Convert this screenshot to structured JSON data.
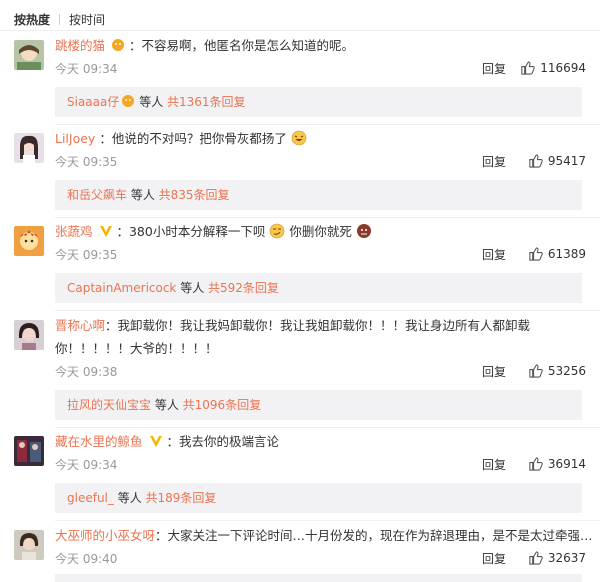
{
  "sort": {
    "hot": "按热度",
    "time": "按时间"
  },
  "labels": {
    "reply": "回复",
    "etc": " 等人 "
  },
  "comments": [
    {
      "user": "跳楼的猫",
      "text": "：不容易啊，他匿名你是怎么知道的呢。",
      "time": "今天 09:34",
      "likes": "116694",
      "sub_user": "Siaaaa仔",
      "sub_count": "共1361条回复"
    },
    {
      "user": "LilJoey",
      "text": "：他说的不对吗？把你骨灰都扬了",
      "time": "今天 09:35",
      "likes": "95417",
      "sub_user": "和岳父飙车",
      "sub_count": "共835条回复"
    },
    {
      "user": "张蔬鸡",
      "text": "：380小时本分解释一下呗",
      "text2": "你删你就死",
      "time": "今天 09:35",
      "likes": "61389",
      "sub_user": "CaptainAmericock",
      "sub_count": "共592条回复"
    },
    {
      "user": "晋称心啊",
      "text": "：我卸载你！我让我妈卸载你！我让我姐卸载你！！！我让身边所有人都卸载",
      "text_line2": "你！！！！！大爷的！！！！",
      "time": "今天 09:38",
      "likes": "53256",
      "sub_user": "拉风的天仙宝宝",
      "sub_count": "共1096条回复"
    },
    {
      "user": "藏在水里的鲸鱼",
      "text": "：我去你的极端言论",
      "time": "今天 09:34",
      "likes": "36914",
      "sub_user": "gleeful_",
      "sub_count": "共189条回复"
    },
    {
      "user": "大巫师的小巫女呀",
      "text": "：大家关注一下评论时间…十月份发的，现在作为辞退理由，是不是太过牵强…",
      "time": "今天 09:40",
      "likes": "32637"
    }
  ],
  "colors": {
    "username": "#eb7350",
    "text": "#333333",
    "meta": "#999999",
    "subbox_bg": "#f2f2f5"
  }
}
